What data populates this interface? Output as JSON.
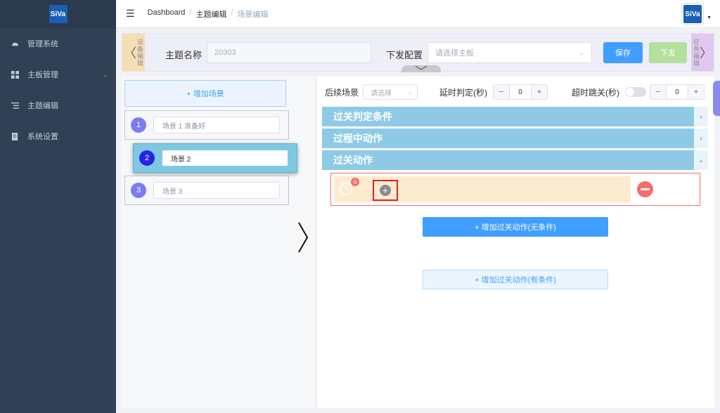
{
  "app": {
    "logo_text": "SiVa",
    "avatar_text": "SiVa"
  },
  "sidebar": {
    "items": [
      {
        "label": "管理系统",
        "icon": "dashboard-icon"
      },
      {
        "label": "主板管理",
        "icon": "grid-icon",
        "has_arrow": true
      },
      {
        "label": "主题编辑",
        "icon": "list-icon"
      },
      {
        "label": "系统设置",
        "icon": "document-icon"
      }
    ]
  },
  "header": {
    "breadcrumb": [
      "Dashboard",
      "主题编辑",
      "场景编辑"
    ],
    "breadcrumb_sep": "/"
  },
  "topbar": {
    "left_tab": "设备编辑",
    "right_tab": "任务编辑",
    "theme_name_label": "主题名称",
    "theme_name_value": "20303",
    "config_label": "下发配置",
    "config_placeholder": "请选择主板",
    "save_label": "保存",
    "send_label": "下发"
  },
  "left_panel": {
    "add_scene_label": "+ 增加场景",
    "scenes": [
      {
        "num": "1",
        "name": "场景 1 准备好"
      },
      {
        "num": "2",
        "name": "场景 2"
      },
      {
        "num": "3",
        "name": "场景 3"
      }
    ]
  },
  "right_panel": {
    "next_scene_label": "后续场景",
    "next_scene_placeholder": "请选择",
    "delay_label": "延时判定(秒)",
    "delay_value": "0",
    "timeout_label": "超时跳关(秒)",
    "timeout_value": "0",
    "minus": "−",
    "plus": "+",
    "sections": [
      {
        "title": "过关判定条件",
        "arrow": "›"
      },
      {
        "title": "过程中动作",
        "arrow": "›"
      },
      {
        "title": "过关动作",
        "arrow": "⌄"
      }
    ],
    "action_badge": "0",
    "add_plus_symbol": "+",
    "add_action_no_cond": "+ 增加过关动作(无条件)",
    "add_action_with_cond": "+ 增加过关动作(有条件)"
  },
  "colors": {
    "accent": "#409eff",
    "sidebar_bg": "#304156",
    "section_bg": "#8ecae6",
    "danger": "#f56c6c"
  }
}
